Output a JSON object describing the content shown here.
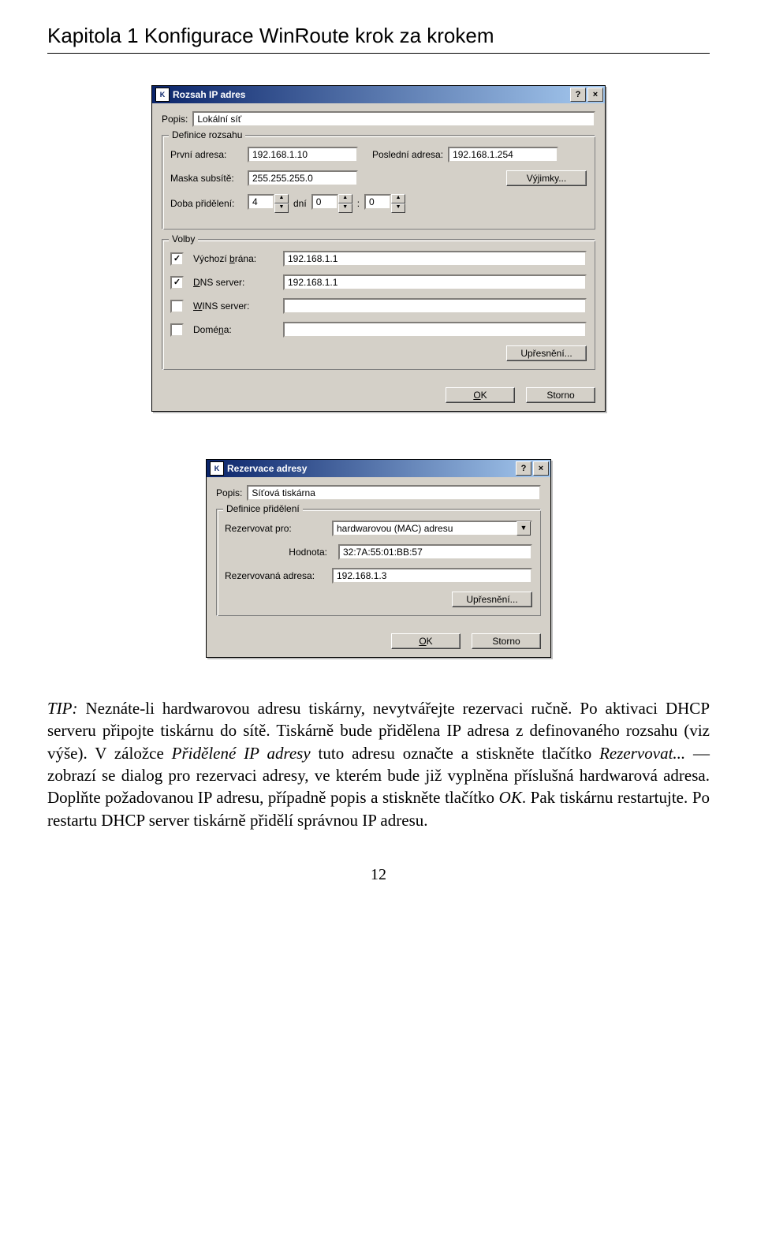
{
  "chapter_title": "Kapitola 1 Konfigurace WinRoute krok za krokem",
  "dialog1": {
    "title": "Rozsah IP adres",
    "desc_label": "Popis:",
    "desc_value": "Lokální síť",
    "range_group_label": "Definice rozsahu",
    "first_addr_label": "První adresa:",
    "first_addr_value": "192.168.1.10",
    "last_addr_label": "Poslední adresa:",
    "last_addr_value": "192.168.1.254",
    "mask_label": "Maska subsítě:",
    "mask_value": "255.255.255.0",
    "except_btn": "Výjimky...",
    "lease_label": "Doba přidělení:",
    "lease_days": "4",
    "lease_days_unit": "dní",
    "lease_hours": "0",
    "lease_sep": ":",
    "lease_mins": "0",
    "options_group_label": "Volby",
    "gateway_checked": true,
    "gateway_label": "Výchozí brána:",
    "gateway_value": "192.168.1.1",
    "dns_checked": true,
    "dns_label": "DNS server:",
    "dns_value": "192.168.1.1",
    "wins_checked": false,
    "wins_label": "WINS server:",
    "wins_value": "",
    "domain_checked": false,
    "domain_label": "Doména:",
    "domain_value": "",
    "advanced_btn": "Upřesnění...",
    "ok_btn": "OK",
    "cancel_btn": "Storno"
  },
  "dialog2": {
    "title": "Rezervace adresy",
    "desc_label": "Popis:",
    "desc_value": "Síťová tiskárna",
    "assign_group_label": "Definice přidělení",
    "reserve_for_label": "Rezervovat pro:",
    "reserve_for_value": "hardwarovou (MAC) adresu",
    "value_label": "Hodnota:",
    "value_value": "32:7A:55:01:BB:57",
    "reserved_addr_label": "Rezervovaná adresa:",
    "reserved_addr_value": "192.168.1.3",
    "advanced_btn": "Upřesnění...",
    "ok_btn": "OK",
    "cancel_btn": "Storno"
  },
  "article": {
    "tip_label": "TIP:",
    "tip_rest": " Neznáte-li hardwarovou adresu tiskárny, nevytvářejte rezervaci ručně. Po aktivaci DHCP serveru připojte tiskárnu do sítě. Tiskárně bude přidělena IP adresa z definovaného rozsahu (viz výše). V záložce ",
    "tab_name": "Přidělené IP adresy",
    "after_tab": " tuto adresu označte a stiskněte tlačítko ",
    "btn_name": "Rezervovat...",
    "after_btn": " — zobrazí se dialog pro rezervaci adresy, ve kterém bude již vyplněna příslušná hardwarová adresa. Doplňte požadovanou IP adresu, případně popis a stiskněte tlačítko ",
    "ok_name": "OK",
    "after_ok": ". Pak tiskárnu restartujte. Po restartu DHCP server tiskárně přidělí správnou IP adresu."
  },
  "page_number": "12"
}
